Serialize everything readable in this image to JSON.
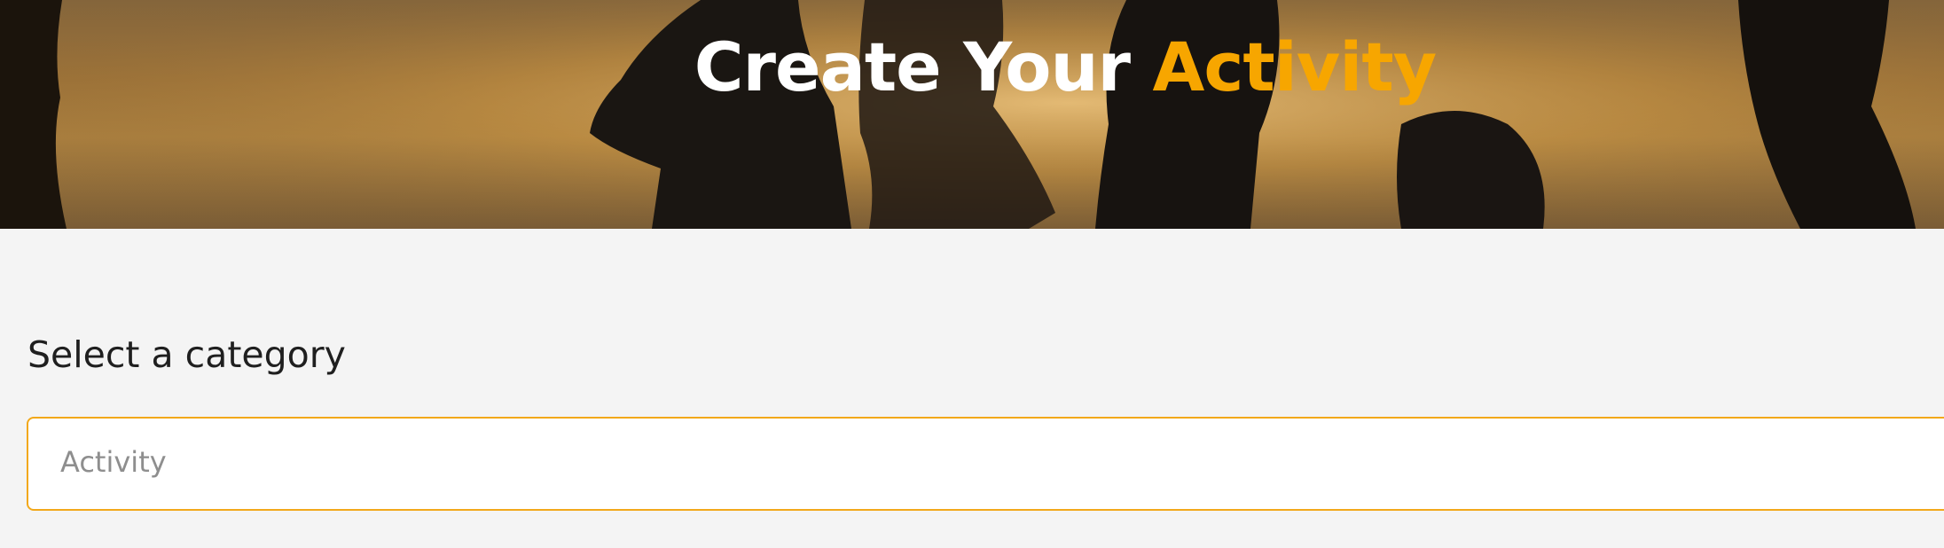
{
  "hero": {
    "title_main": "Create Your ",
    "title_accent": "Activity",
    "accent_color": "#f7a600"
  },
  "form": {
    "category_label": "Select a category",
    "category_select": {
      "value": "Activity",
      "border_color": "#f2a81a"
    }
  }
}
